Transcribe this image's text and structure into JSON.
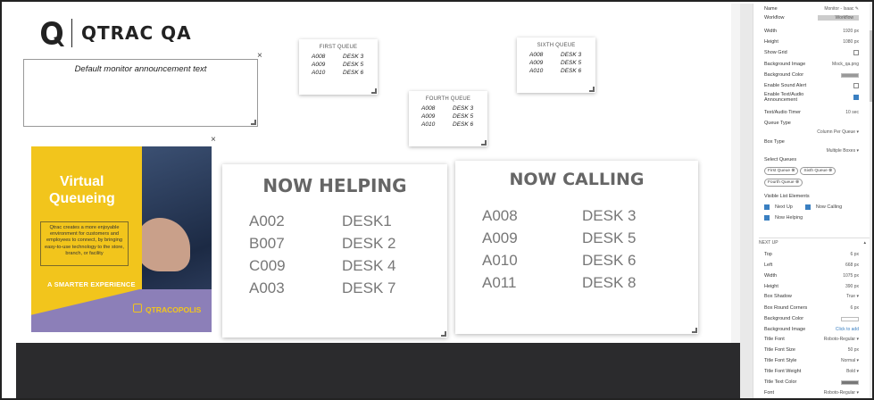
{
  "logo": {
    "text": "QTRAC QA"
  },
  "announcement": {
    "text": "Default monitor announcement text",
    "close": "×"
  },
  "queues_small": [
    {
      "title": "FIRST QUEUE",
      "rows": [
        [
          "A008",
          "DESK 3"
        ],
        [
          "A009",
          "DESK 5"
        ],
        [
          "A010",
          "DESK 6"
        ]
      ]
    },
    {
      "title": "FOURTH QUEUE",
      "rows": [
        [
          "A008",
          "DESK 3"
        ],
        [
          "A009",
          "DESK 5"
        ],
        [
          "A010",
          "DESK 6"
        ]
      ]
    },
    {
      "title": "SIXTH QUEUE",
      "rows": [
        [
          "A008",
          "DESK 3"
        ],
        [
          "A009",
          "DESK 5"
        ],
        [
          "A010",
          "DESK 6"
        ]
      ]
    }
  ],
  "promo": {
    "title_line1": "Virtual",
    "title_line2": "Queueing",
    "body": "Qtrac creates a more enjoyable environment for customers and employees to connect, by bringing easy-to-use technology to the store, branch, or facility",
    "tagline": "A SMARTER EXPERIENCE",
    "brand": "QTRACOPOLIS",
    "close": "×"
  },
  "now_helping": {
    "title": "NOW HELPING",
    "rows": [
      [
        "A002",
        "DESK1"
      ],
      [
        "B007",
        "DESK 2"
      ],
      [
        "C009",
        "DESK 4"
      ],
      [
        "A003",
        "DESK 7"
      ]
    ]
  },
  "now_calling": {
    "title": "NOW CALLING",
    "rows": [
      [
        "A008",
        "DESK 3"
      ],
      [
        "A009",
        "DESK 5"
      ],
      [
        "A010",
        "DESK 6"
      ],
      [
        "A011",
        "DESK 8"
      ]
    ]
  },
  "panel": {
    "name_label": "Name",
    "name_value": "Monitor - Isaac",
    "workflow_label": "Workflow",
    "workflow_value": "Workflow",
    "width_label": "Width",
    "width_value": "1920 px",
    "height_label": "Height",
    "height_value": "1080 px",
    "showgrid_label": "Show Grid",
    "bgimage_label": "Background Image",
    "bgimage_value": "Mock_qa.png",
    "bgcolor_label": "Background Color",
    "sound_label": "Enable Sound Alert",
    "tts_label": "Enable Text/Audio Announcement",
    "timer_label": "Text/Audio Timer",
    "timer_value": "10 sec",
    "qtype_label": "Queue Type",
    "qtype_value": "Column Per Queue",
    "btype_label": "Box Type",
    "btype_value": "Multiple Boxes",
    "selq_label": "Select Queues",
    "chips": [
      "First Queue",
      "Sixth Queue",
      "Fourth Queue"
    ],
    "visible_label": "Visible List Elements",
    "next_up": "Next Up",
    "now_calling": "Now Calling",
    "now_helping": "Now Helping",
    "section_next_up": "NEXT UP",
    "top_label": "Top",
    "top_value": "6 px",
    "left_label": "Left",
    "left_value": "668 px",
    "w2_label": "Width",
    "w2_value": "1075 px",
    "h2_label": "Height",
    "h2_value": "390 px",
    "shadow_label": "Box Shadow",
    "shadow_value": "True",
    "corners_label": "Box Round Corners",
    "corners_value": "6 px",
    "bgc2_label": "Background Color",
    "bgi2_label": "Background Image",
    "bgi2_value": "Click to add",
    "tf_label": "Title Font",
    "tf_value": "Roboto-Regular",
    "tfs_label": "Title Font Size",
    "tfs_value": "50 px",
    "tfst_label": "Title Font Style",
    "tfst_value": "Normal",
    "tfw_label": "Title Font Weight",
    "tfw_value": "Bold",
    "ttc_label": "Title Text Color",
    "font_label": "Font",
    "font_value": "Roboto-Regular"
  }
}
